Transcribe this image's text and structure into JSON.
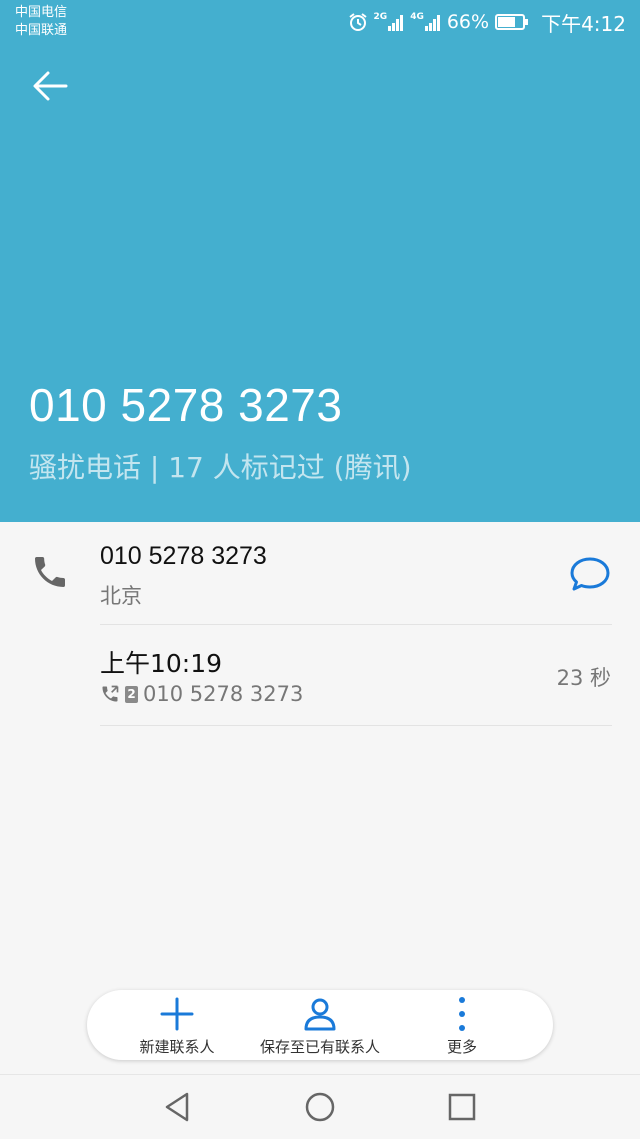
{
  "status_bar": {
    "carrier1": "中国电信",
    "carrier2": "中国联通",
    "net1": "2G",
    "net2": "4G",
    "battery_pct": "66%",
    "time": "下午4:12"
  },
  "header": {
    "number": "010 5278 3273",
    "tag_line": "骚扰电话 | 17 人标记过 (腾讯)",
    "bg_color": "#44afcf"
  },
  "contact_row": {
    "number": "010 5278 3273",
    "location": "北京"
  },
  "call_log": {
    "time": "上午10:19",
    "sim": "2",
    "number": "010 5278 3273",
    "duration": "23 秒"
  },
  "actions": {
    "new_contact": "新建联系人",
    "save_existing": "保存至已有联系人",
    "more": "更多",
    "accent": "#1a7ad9"
  }
}
